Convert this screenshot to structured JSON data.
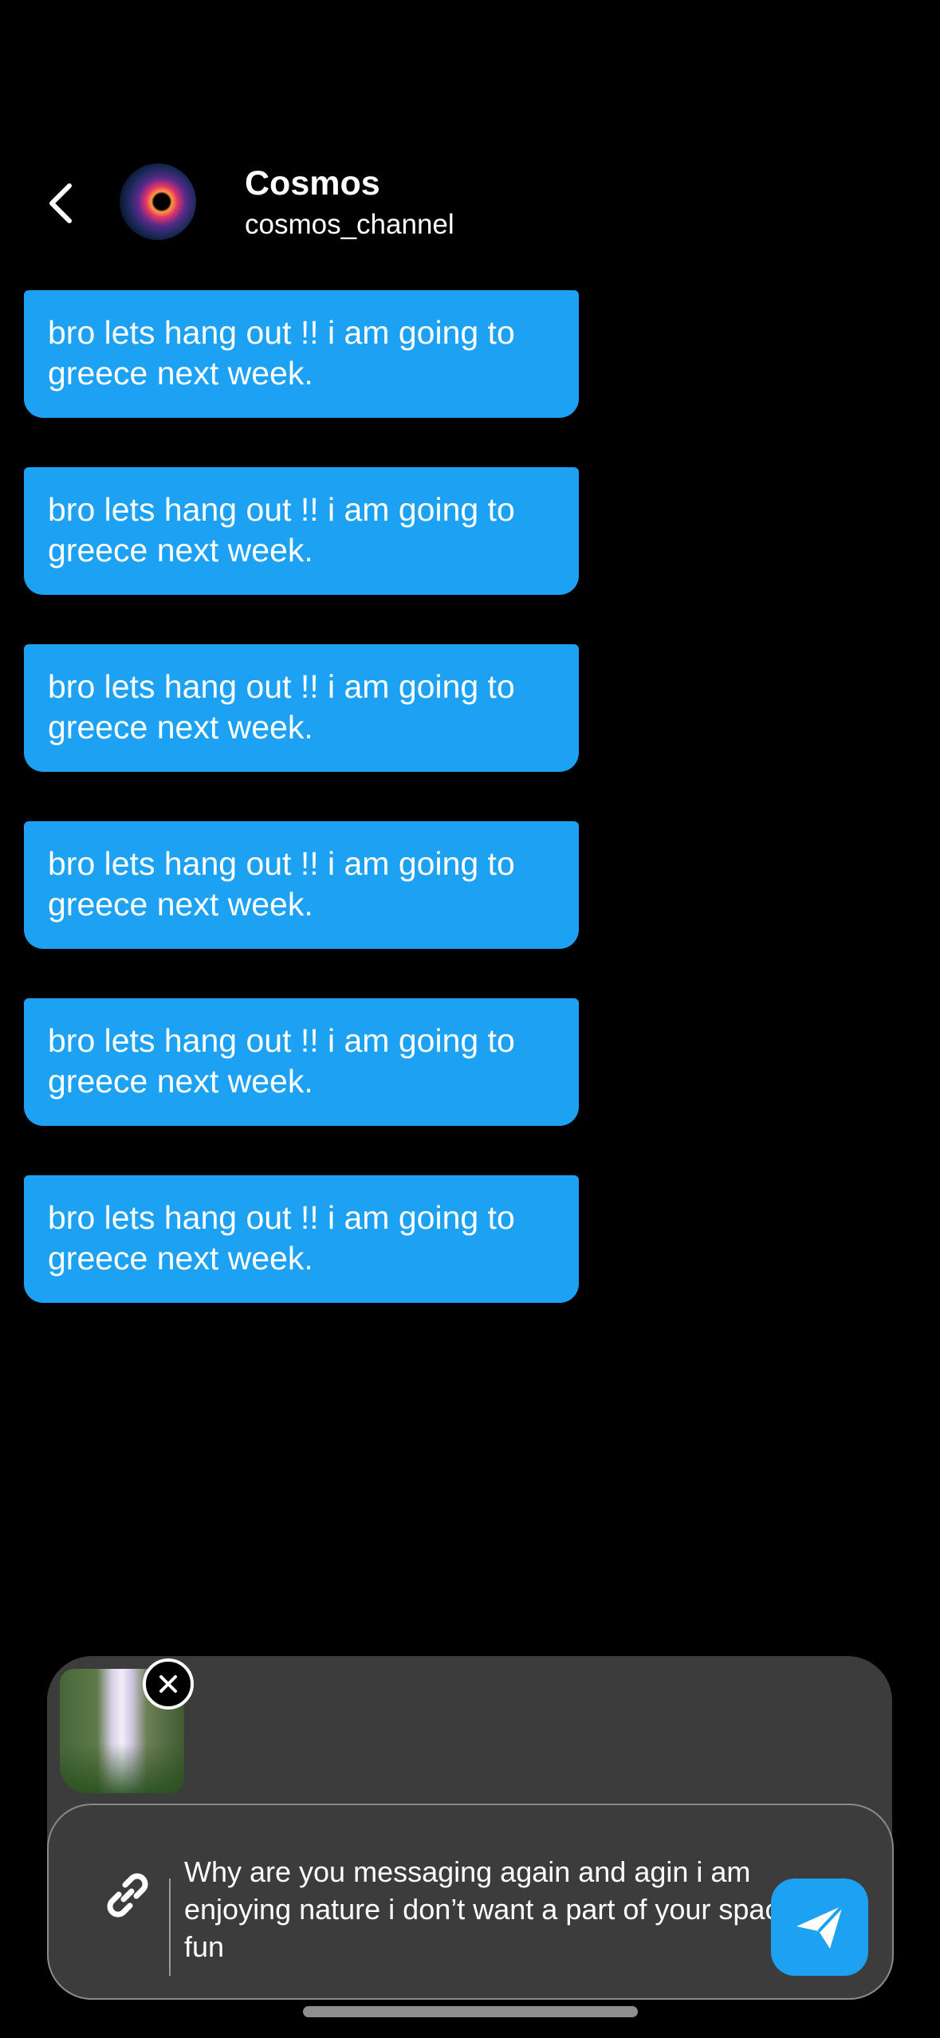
{
  "header": {
    "back_icon": "chevron-left-icon",
    "name": "Cosmos",
    "handle": "cosmos_channel"
  },
  "messages": [
    {
      "text": "bro lets hang out !! i am going to greece next week."
    },
    {
      "text": "bro lets hang out !! i am going to greece next week."
    },
    {
      "text": "bro lets hang out !! i am going to greece next week."
    },
    {
      "text": "bro lets hang out !! i am going to greece next week."
    },
    {
      "text": "bro lets hang out !! i am going to greece next week."
    },
    {
      "text": "bro lets hang out !! i am going to greece next week."
    }
  ],
  "composer": {
    "attachment_icon": "image-thumbnail",
    "remove_icon": "close-circle-icon",
    "link_icon": "link-icon",
    "input_value": "Why are you messaging again and agin i am enjoying nature i don’t want a part of your space fun",
    "send_icon": "paper-plane-icon"
  },
  "colors": {
    "background": "#000000",
    "bubble": "#1da1f2",
    "composer": "#3c3c3c",
    "send_button": "#1da1f2"
  }
}
